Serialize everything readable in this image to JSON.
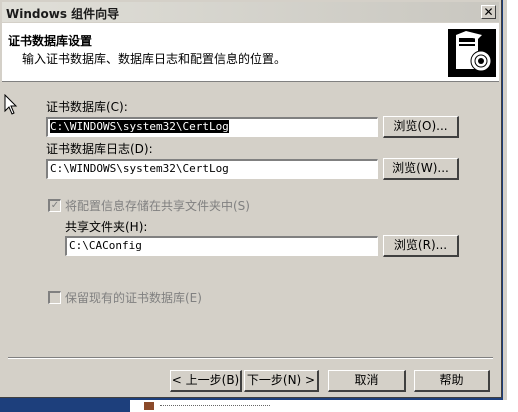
{
  "window": {
    "title": "Windows 组件向导",
    "close_glyph": "✕"
  },
  "header": {
    "title": "证书数据库设置",
    "subtitle": "输入证书数据库、数据库日志和配置信息的位置。"
  },
  "fields": {
    "db_label": "证书数据库(C):",
    "db_value": "C:\\WINDOWS\\system32\\CertLog",
    "db_browse": "浏览(O)...",
    "log_label": "证书数据库日志(D):",
    "log_value": "C:\\WINDOWS\\system32\\CertLog",
    "log_browse": "浏览(W)...",
    "share_checkbox_label": "将配置信息存储在共享文件夹中(S)",
    "share_checked": true,
    "share_folder_label": "共享文件夹(H):",
    "share_folder_value": "C:\\CAConfig",
    "share_browse": "浏览(R)...",
    "keep_db_label": "保留现有的证书数据库(E)",
    "keep_db_checked": false
  },
  "buttons": {
    "back": "< 上一步(B)",
    "next": "下一步(N) >",
    "cancel": "取消",
    "help": "帮助"
  },
  "icons": [
    "wizard-box-cd-icon",
    "mouse-cursor-icon",
    "close-icon"
  ],
  "colors": {
    "dialog_face": "#d4d0c8",
    "desktop": "#1d3f7c",
    "disabled_text": "#808080"
  }
}
